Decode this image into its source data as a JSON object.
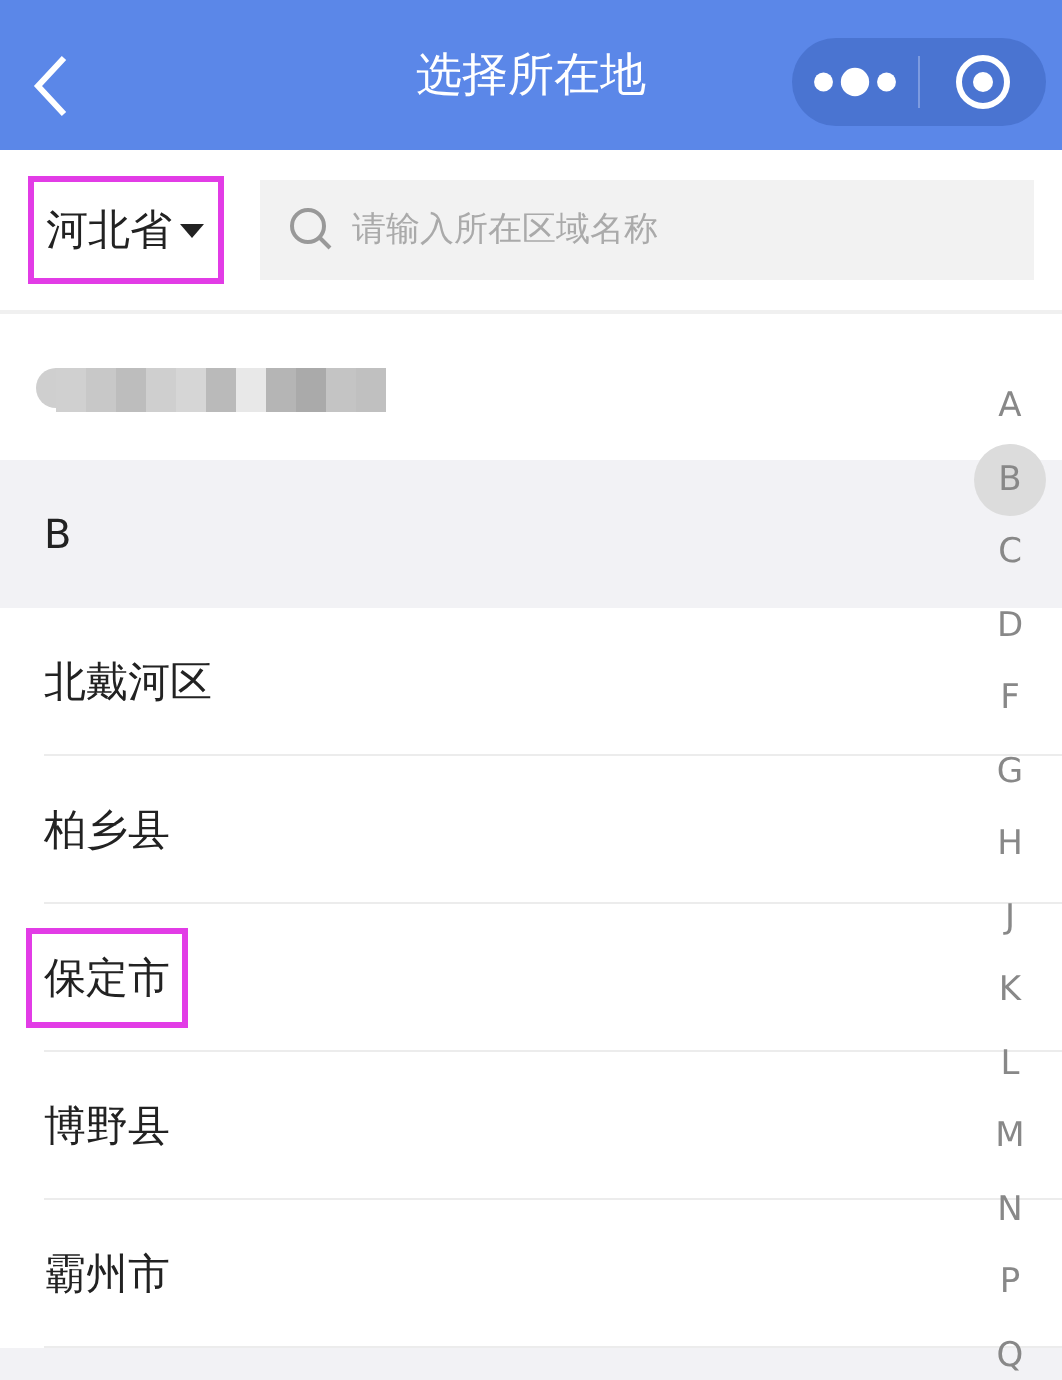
{
  "header": {
    "title": "选择所在地"
  },
  "filter": {
    "province": "河北省",
    "highlighted": true,
    "search_placeholder": "请输入所在区域名称"
  },
  "top_row": {
    "kind": "blurred"
  },
  "sections": [
    {
      "letter": "B",
      "items": [
        {
          "name": "北戴河区",
          "highlighted": false
        },
        {
          "name": "柏乡县",
          "highlighted": false
        },
        {
          "name": "保定市",
          "highlighted": true
        },
        {
          "name": "博野县",
          "highlighted": false
        },
        {
          "name": "霸州市",
          "highlighted": false
        }
      ]
    }
  ],
  "index": [
    {
      "letter": "A",
      "selected": false
    },
    {
      "letter": "B",
      "selected": true
    },
    {
      "letter": "C",
      "selected": false
    },
    {
      "letter": "D",
      "selected": false
    },
    {
      "letter": "F",
      "selected": false
    },
    {
      "letter": "G",
      "selected": false
    },
    {
      "letter": "H",
      "selected": false
    },
    {
      "letter": "J",
      "selected": false
    },
    {
      "letter": "K",
      "selected": false
    },
    {
      "letter": "L",
      "selected": false
    },
    {
      "letter": "M",
      "selected": false
    },
    {
      "letter": "N",
      "selected": false
    },
    {
      "letter": "P",
      "selected": false
    },
    {
      "letter": "Q",
      "selected": false
    }
  ]
}
